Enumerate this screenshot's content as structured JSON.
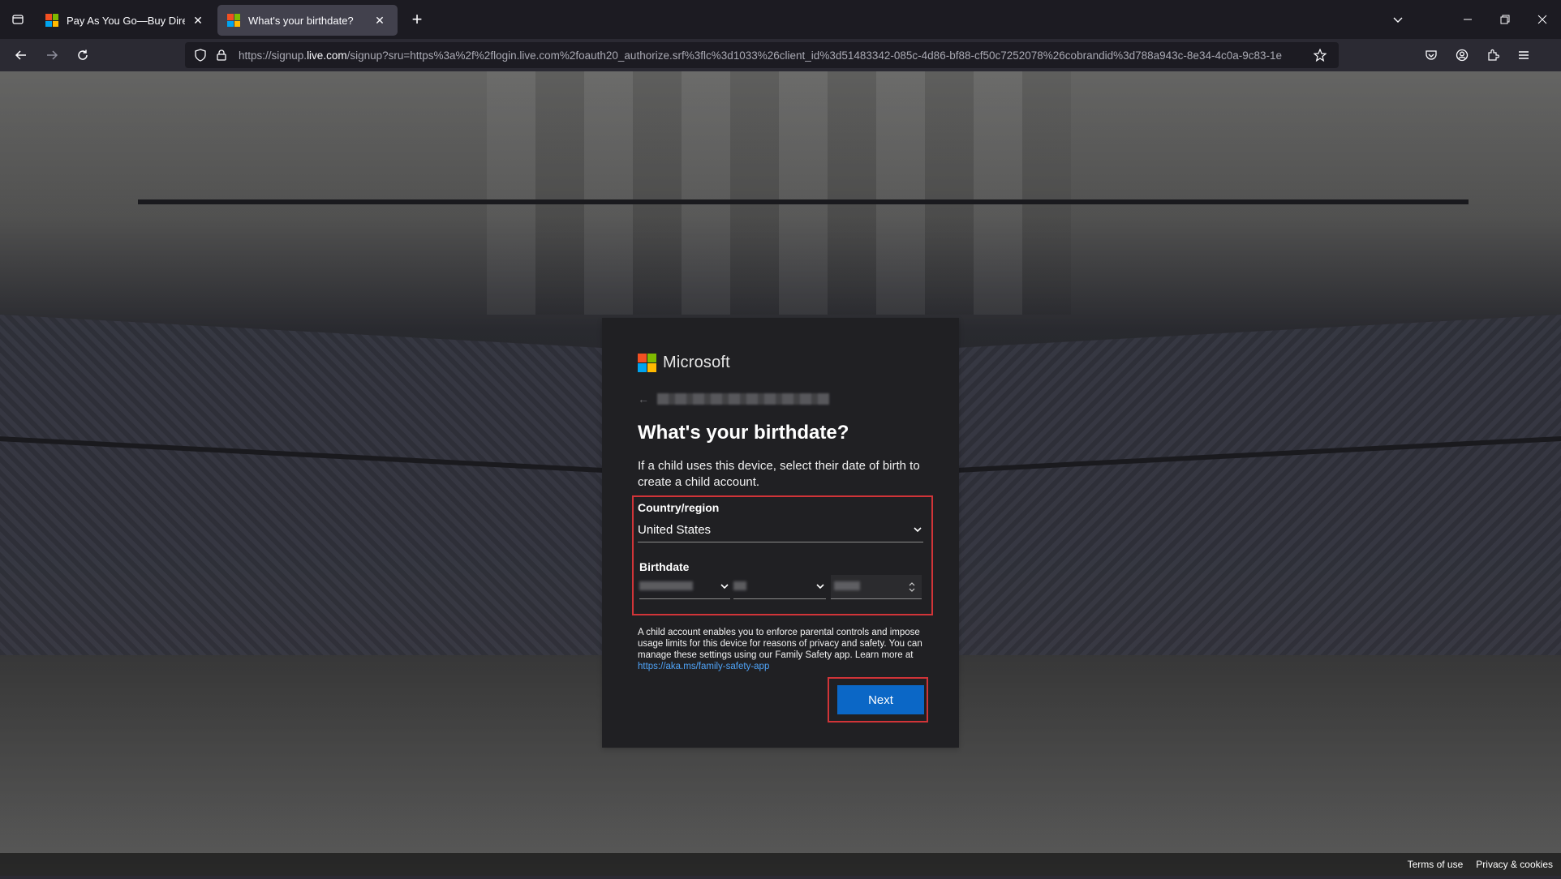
{
  "browser": {
    "tabs": [
      {
        "title": "Pay As You Go—Buy Directly | Mic",
        "active": false
      },
      {
        "title": "What's your birthdate?",
        "active": true
      }
    ],
    "url_prefix": "https://signup.",
    "url_domain": "live.com",
    "url_rest": "/signup?sru=https%3a%2f%2flogin.live.com%2foauth20_authorize.srf%3flc%3d1033%26client_id%3d51483342-085c-4d86-bf88-cf50c7252078%26cobrandid%3d788a943c-8e34-4c0a-9c83-1e"
  },
  "brand": {
    "name": "Microsoft",
    "logo_colors": [
      "#f25022",
      "#7fba00",
      "#00a4ef",
      "#ffb900"
    ]
  },
  "page": {
    "heading": "What's your birthdate?",
    "description": "If a child uses this device, select their date of birth to create a child account.",
    "country_label": "Country/region",
    "country_value": "United States",
    "birthdate_label": "Birthdate",
    "info_text": "A child account enables you to enforce parental controls and impose usage limits for this device for reasons of privacy and safety. You can manage these settings using our Family Safety app. Learn more at",
    "info_link": "https://aka.ms/family-safety-app",
    "next_label": "Next"
  },
  "footer": {
    "terms": "Terms of use",
    "privacy": "Privacy & cookies"
  },
  "colors": {
    "highlight_border": "#d13438",
    "next_button": "#0b67c6",
    "link": "#4fa3f7"
  }
}
